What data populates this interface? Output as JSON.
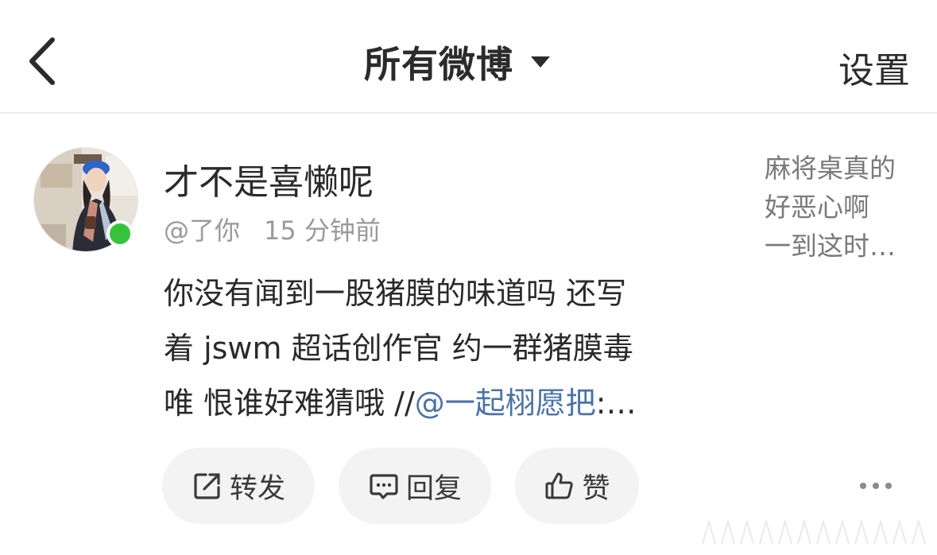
{
  "header": {
    "title": "所有微博",
    "settings_label": "设置"
  },
  "post": {
    "username": "才不是喜懒呢",
    "handle": "@了你",
    "time": "15 分钟前",
    "content": {
      "line1": "你没有闻到一股猪膜的味道吗 还写",
      "line2": "着 jswm 超话创作官 约一群猪膜毒",
      "line3_prefix": "唯 恨谁好难猜哦 //",
      "mention": "@一起栩愿把",
      "line3_suffix": ":…"
    },
    "quote": {
      "line1": "麻将桌真的",
      "line2": "好恶心啊",
      "line3": "一到这时…"
    },
    "actions": {
      "forward_label": "转发",
      "reply_label": "回复",
      "like_label": "赞"
    }
  },
  "icons": {
    "back": "chevron-left-icon",
    "dropdown": "caret-down-icon",
    "forward": "share-icon",
    "reply": "comment-icon",
    "like": "thumbs-up-icon",
    "more": "more-dots-icon"
  },
  "colors": {
    "mention": "#4b72a7",
    "online": "#36c33b",
    "meta": "#9a9a9a",
    "button_bg": "#f3f3f3"
  }
}
